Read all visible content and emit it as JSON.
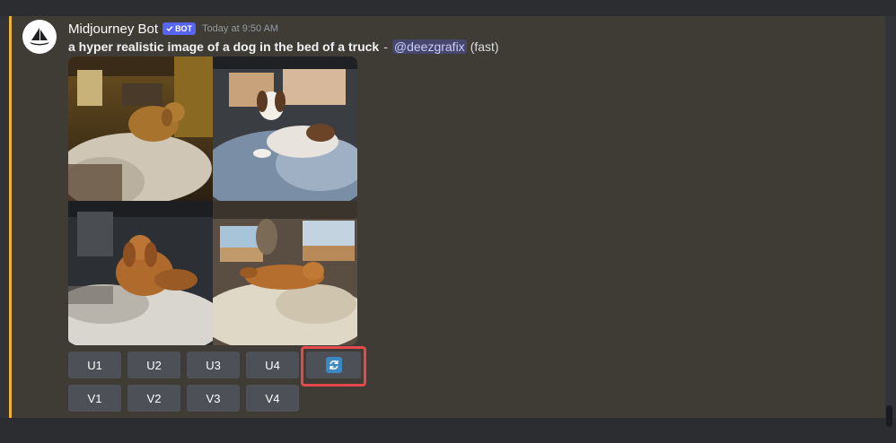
{
  "message": {
    "username": "Midjourney Bot",
    "bot_badge": "BOT",
    "timestamp": "Today at 9:50 AM",
    "prompt": "a hyper realistic image of a dog in the bed of a truck",
    "separator": "-",
    "mention": "@deezgrafix",
    "speed": "(fast)"
  },
  "buttons": {
    "upscale": [
      "U1",
      "U2",
      "U3",
      "U4"
    ],
    "variation": [
      "V1",
      "V2",
      "V3",
      "V4"
    ]
  },
  "colors": {
    "accent_border": "#f0b232",
    "highlight": "#e5484d",
    "button_bg": "#4e5058",
    "bot_badge": "#5865f2",
    "redo_icon": "#3b88c3"
  },
  "icons": {
    "avatar": "midjourney-boat-logo",
    "redo": "refresh-icon",
    "verified": "checkmark-icon"
  }
}
